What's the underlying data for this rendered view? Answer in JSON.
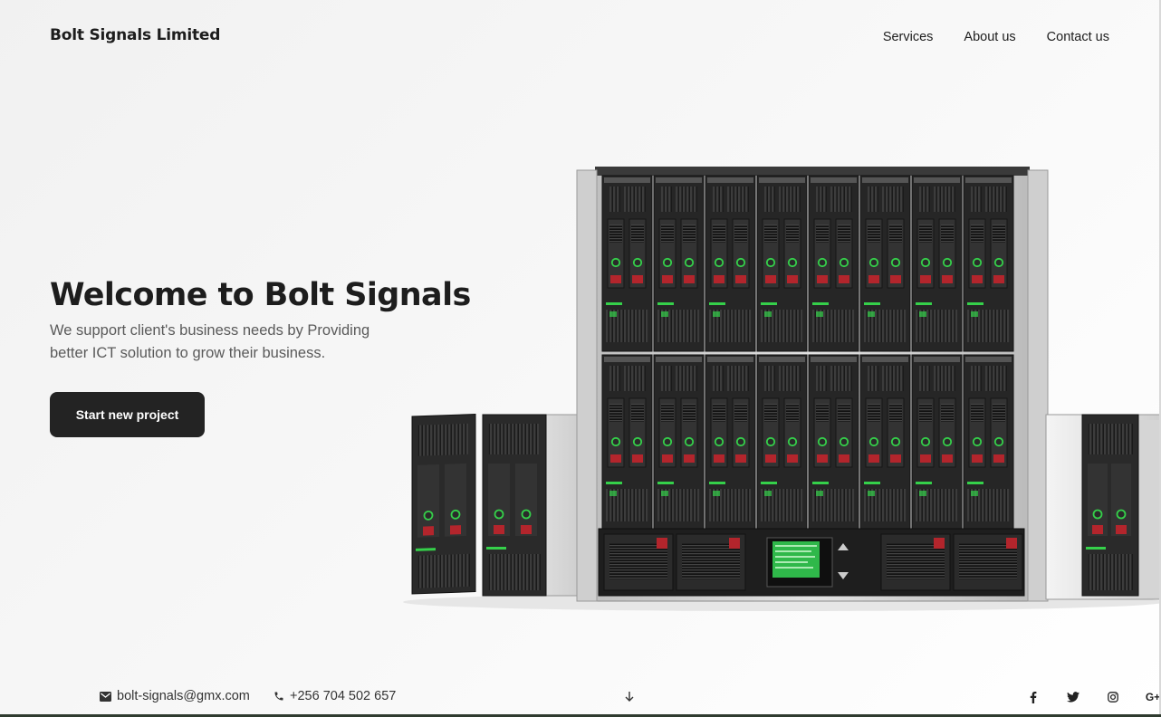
{
  "header": {
    "brand": "Bolt Signals Limited",
    "nav": [
      "Services",
      "About us",
      "Contact us"
    ]
  },
  "hero": {
    "title": "Welcome to Bolt Signals",
    "text": "We support client's business needs by Providing better ICT solution to grow their business.",
    "cta": "Start new project",
    "image": "blade-server-enclosure"
  },
  "footer": {
    "email": "bolt-signals@gmx.com",
    "phone": "+256 704 502 657",
    "email_icon": "envelope-icon",
    "phone_icon": "phone-icon",
    "scroll_icon": "arrow-down-icon",
    "social": [
      "facebook-icon",
      "twitter-icon",
      "instagram-icon",
      "google-plus-icon"
    ],
    "gplus_glyph": "G+"
  },
  "colors": {
    "text_dark": "#1d1d1d",
    "text_muted": "#5a5a5a",
    "button_bg": "#232323",
    "led_green": "#35d04a",
    "handle_red": "#b3252c"
  }
}
